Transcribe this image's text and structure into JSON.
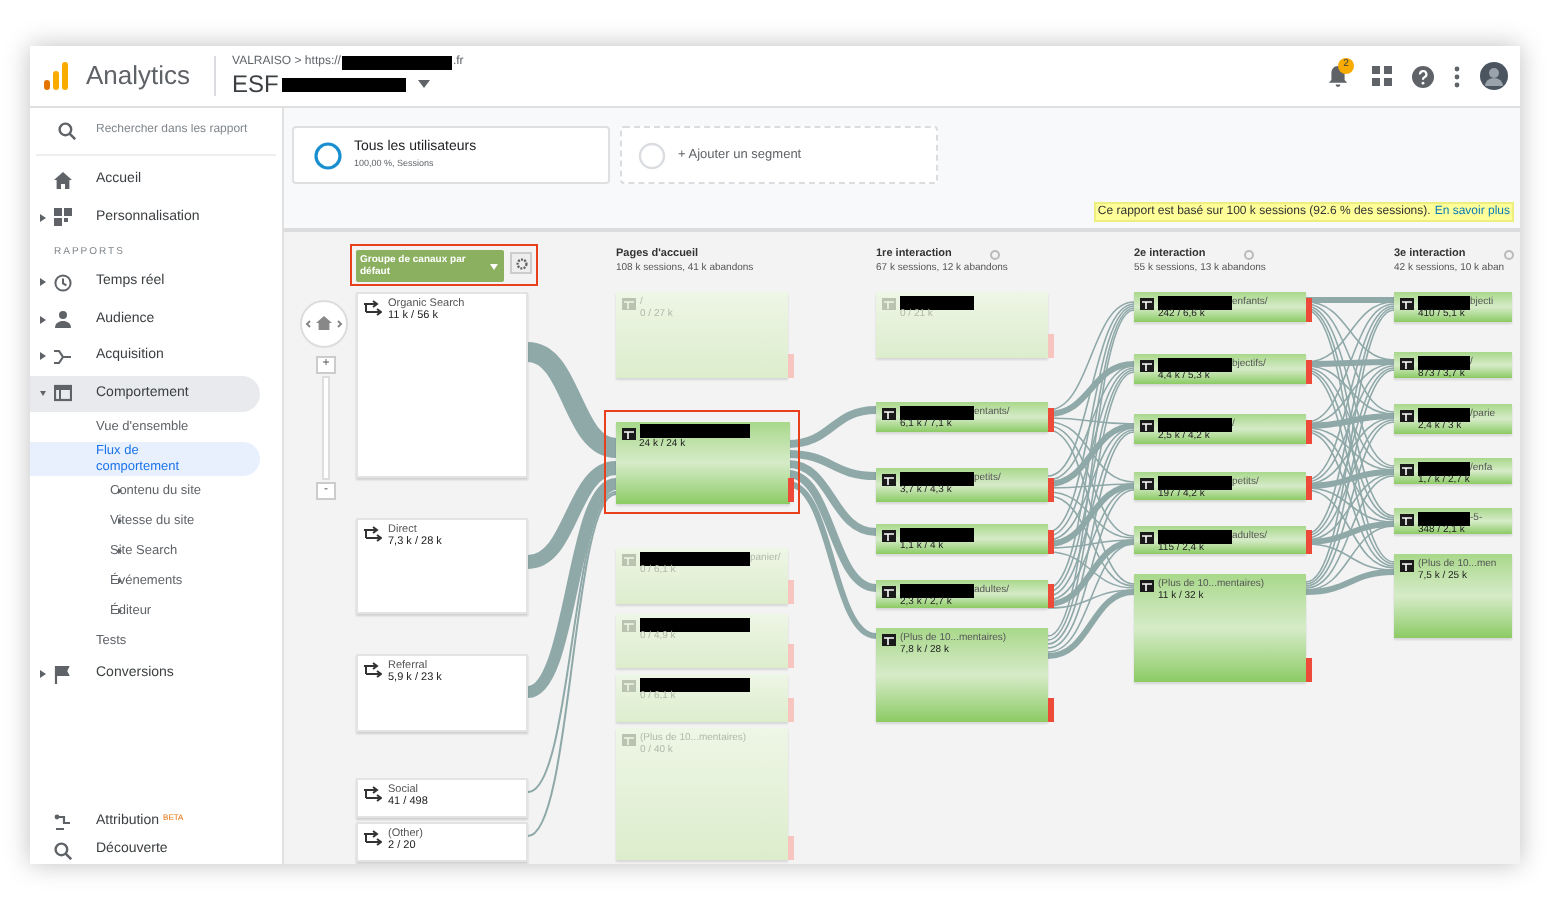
{
  "header": {
    "app_name": "Analytics",
    "breadcrumb_prefix": "VALRAISO > https://",
    "breadcrumb_suffix": ".fr",
    "property": "ESF",
    "notification_count": "2"
  },
  "sidebar": {
    "search": {
      "placeholder": "Rechercher dans les rapport"
    },
    "items": [
      {
        "kind": "item",
        "label": "Accueil",
        "expandable": false,
        "selected": false
      },
      {
        "kind": "item",
        "label": "Personnalisation",
        "expandable": true,
        "selected": false
      },
      {
        "kind": "section",
        "label": "RAPPORTS"
      },
      {
        "kind": "item",
        "label": "Temps réel",
        "expandable": true,
        "selected": false
      },
      {
        "kind": "item",
        "label": "Audience",
        "expandable": true,
        "selected": false
      },
      {
        "kind": "item",
        "label": "Acquisition",
        "expandable": true,
        "selected": false
      },
      {
        "kind": "item",
        "label": "Comportement",
        "expandable": true,
        "expanded": true,
        "selected": false
      },
      {
        "kind": "sub",
        "label": "Vue d'ensemble",
        "expandable": false,
        "selected": false
      },
      {
        "kind": "sub",
        "label": "Flux de comportement",
        "expandable": false,
        "selected": true
      },
      {
        "kind": "sub",
        "label": "Contenu du site",
        "expandable": true,
        "selected": false
      },
      {
        "kind": "sub",
        "label": "Vitesse du site",
        "expandable": true,
        "selected": false
      },
      {
        "kind": "sub",
        "label": "Site Search",
        "expandable": true,
        "selected": false
      },
      {
        "kind": "sub",
        "label": "Événements",
        "expandable": true,
        "selected": false
      },
      {
        "kind": "sub",
        "label": "Éditeur",
        "expandable": true,
        "selected": false
      },
      {
        "kind": "sub",
        "label": "Tests",
        "expandable": false,
        "selected": false
      },
      {
        "kind": "item",
        "label": "Conversions",
        "expandable": true,
        "selected": false
      }
    ],
    "bottom_items": [
      {
        "label": "Attribution",
        "badge": "BETA"
      },
      {
        "label": "Découverte"
      }
    ]
  },
  "segments": [
    {
      "kind": "active",
      "title": "Tous les utilisateurs",
      "subtitle": "100,00 %, Sessions"
    },
    {
      "kind": "add",
      "title": "+ Ajouter un segment"
    }
  ],
  "notice": {
    "text": "Ce rapport est basé sur 100 k sessions (92.6 % des sessions).",
    "link": "En savoir plus"
  },
  "flow": {
    "dimension": "Groupe de canaux par défaut",
    "zoom_in": "+",
    "zoom_out": "-",
    "sources": [
      {
        "label": "Organic Search",
        "stats": "11 k / 56 k"
      },
      {
        "label": "Direct",
        "stats": "7,3 k / 28 k"
      },
      {
        "label": "Referral",
        "stats": "5,9 k / 23 k"
      },
      {
        "label": "Social",
        "stats": "41 / 498"
      },
      {
        "label": "(Other)",
        "stats": "2 / 20"
      }
    ],
    "columns": [
      {
        "title": "Pages d'accueil",
        "subtitle": "108 k sessions, 41 k abandons",
        "settings": false,
        "nodes": [
          {
            "redacted": false,
            "label": "/",
            "stats": "0 / 27 k",
            "faded": true,
            "highlighted": false
          },
          {
            "redacted": true,
            "stats": "24 k / 24 k",
            "faded": false,
            "highlighted": true
          },
          {
            "redacted": true,
            "label": "panier/",
            "stats": "0 / 6,1 k",
            "faded": true,
            "highlighted": false
          },
          {
            "redacted": true,
            "stats": "0 / 4,9 k",
            "faded": true,
            "highlighted": false
          },
          {
            "redacted": true,
            "stats": "0 / 6,1 k",
            "faded": true,
            "highlighted": false
          },
          {
            "redacted": false,
            "label": "(Plus de 10...mentaires)",
            "stats": "0 / 40 k",
            "faded": true,
            "highlighted": false
          }
        ]
      },
      {
        "title": "1re interaction",
        "subtitle": "67 k sessions, 12 k abandons",
        "settings": true,
        "nodes": [
          {
            "redacted": true,
            "stats": "0 / 21 k",
            "faded": true,
            "highlighted": false
          },
          {
            "redacted": true,
            "label": "entants/",
            "stats": "6,1 k / 7,1 k",
            "faded": false,
            "highlighted": false
          },
          {
            "redacted": true,
            "label": "petits/",
            "stats": "3,7 k / 4,3 k",
            "faded": false,
            "highlighted": false
          },
          {
            "redacted": true,
            "stats": "1,1 k / 4 k",
            "faded": false,
            "highlighted": false
          },
          {
            "redacted": true,
            "label": "adultes/",
            "stats": "2,3 k / 2,7 k",
            "faded": false,
            "highlighted": false
          },
          {
            "redacted": false,
            "label": "(Plus de 10...mentaires)",
            "stats": "7,8 k / 28 k",
            "faded": false,
            "highlighted": false
          }
        ]
      },
      {
        "title": "2e interaction",
        "subtitle": "55 k sessions, 13 k abandons",
        "settings": true,
        "nodes": [
          {
            "redacted": true,
            "label": "enfants/",
            "stats": "242 / 6,6 k",
            "faded": false,
            "highlighted": false
          },
          {
            "redacted": true,
            "label": "bjectifs/",
            "stats": "4,4 k / 5,3 k",
            "faded": false,
            "highlighted": false
          },
          {
            "redacted": true,
            "label": "/",
            "stats": "2,5 k / 4,2 k",
            "faded": false,
            "highlighted": false
          },
          {
            "redacted": true,
            "label": "petits/",
            "stats": "197 / 4,2 k",
            "faded": false,
            "highlighted": false
          },
          {
            "redacted": true,
            "label": "adultes/",
            "stats": "115 / 2,4 k",
            "faded": false,
            "highlighted": false
          },
          {
            "redacted": false,
            "label": "(Plus de 10...mentaires)",
            "stats": "11 k / 32 k",
            "faded": false,
            "highlighted": false
          }
        ]
      },
      {
        "title": "3e interaction",
        "subtitle": "42 k sessions, 10 k aban",
        "settings": true,
        "nodes": [
          {
            "redacted": true,
            "label": "bjecti",
            "stats": "410 / 5,1 k",
            "faded": false,
            "highlighted": false
          },
          {
            "redacted": true,
            "label": "/",
            "stats": "873 / 3,7 k",
            "faded": false,
            "highlighted": false
          },
          {
            "redacted": true,
            "label": "/parie",
            "stats": "2,4 k / 3 k",
            "faded": false,
            "highlighted": false
          },
          {
            "redacted": true,
            "label": "/enfa",
            "stats": "1,7 k / 2,7 k",
            "faded": false,
            "highlighted": false
          },
          {
            "redacted": true,
            "label": "-5-",
            "stats": "348 / 2,1 k",
            "faded": false,
            "highlighted": false
          },
          {
            "redacted": false,
            "label": "(Plus de 10...men",
            "stats": "7,5 k / 25 k",
            "faded": false,
            "highlighted": false
          }
        ]
      }
    ]
  }
}
